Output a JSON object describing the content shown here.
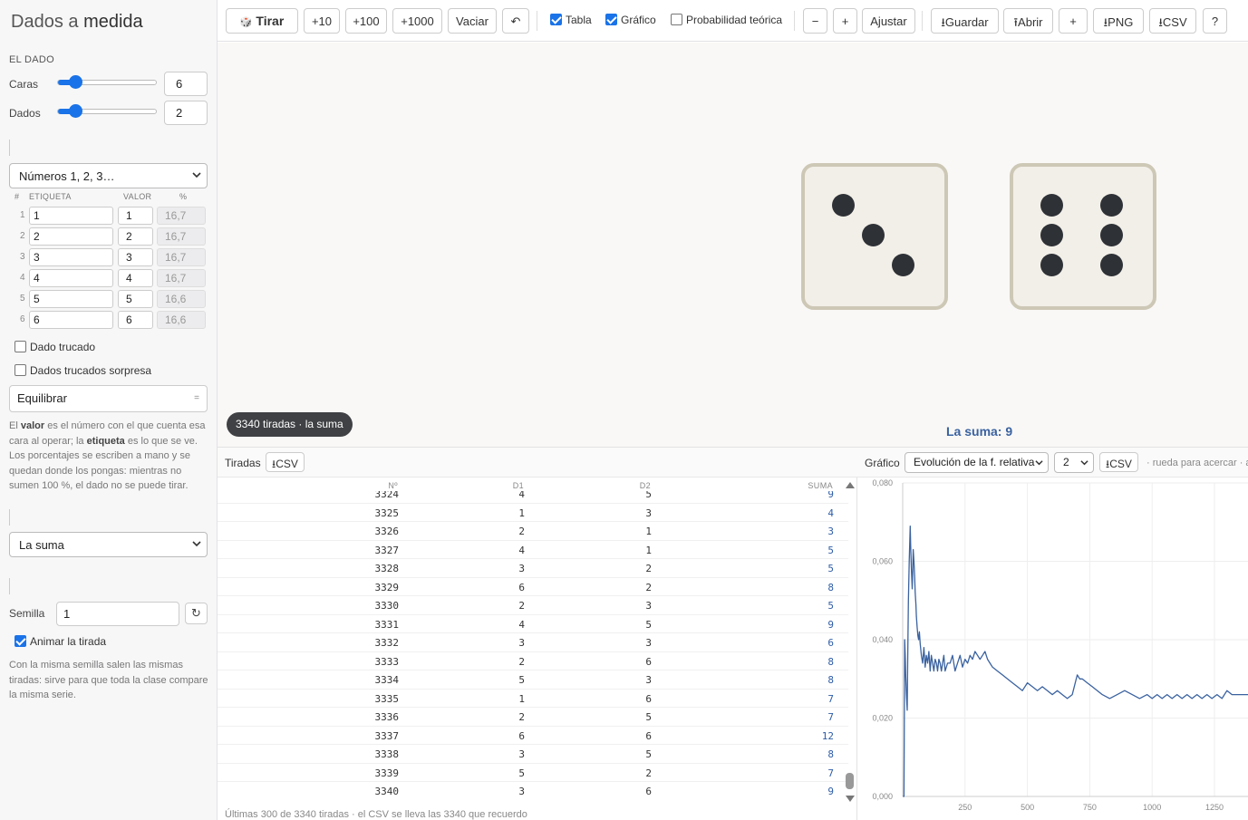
{
  "app": {
    "title_light": "Dados a ",
    "title_bold": "medida"
  },
  "sidebar": {
    "section_die": "EL DADO",
    "faces_label": "Caras",
    "faces_value": "6",
    "faces_level": 0.1,
    "dice_label": "Dados",
    "dice_value": "2",
    "dice_level": 0.1,
    "preset_select": "Números 1, 2, 3…",
    "table_headers": {
      "idx": "#",
      "label": "ETIQUETA",
      "value": "VALOR",
      "pct": "%"
    },
    "faces": [
      {
        "idx": "1",
        "label": "1",
        "value": "1",
        "pct": "16,7"
      },
      {
        "idx": "2",
        "label": "2",
        "value": "2",
        "pct": "16,7"
      },
      {
        "idx": "3",
        "label": "3",
        "value": "3",
        "pct": "16,7"
      },
      {
        "idx": "4",
        "label": "4",
        "value": "4",
        "pct": "16,7"
      },
      {
        "idx": "5",
        "label": "5",
        "value": "5",
        "pct": "16,6"
      },
      {
        "idx": "6",
        "label": "6",
        "value": "6",
        "pct": "16,6"
      }
    ],
    "loaded_die": {
      "label": "Dado trucado",
      "checked": false
    },
    "surprise_dice": {
      "label": "Dados trucados sorpresa",
      "checked": false
    },
    "balance_button": "Equilibrar",
    "balance_icon": "=",
    "help_value": {
      "p1": "El ",
      "b1": "valor",
      "p2": " es el número con el que cuenta esa cara al operar; la ",
      "b2": "etiqueta",
      "p3": " es lo que se ve. Los porcentajes se escriben a mano y se quedan donde los pongas: mientras no sumen 100 %, el dado no se puede tirar."
    },
    "operation_select": "La suma",
    "seed_label": "Semilla",
    "seed_value": "1",
    "refresh_icon": "↻",
    "animate": {
      "label": "Animar la tirada",
      "checked": true
    },
    "help_seed": "Con la misma semilla salen las mismas tiradas: sirve para que toda la clase compare la misma serie."
  },
  "toolbar": {
    "roll_icon": "🎲",
    "roll": "Tirar",
    "plus10": "+10",
    "plus100": "+100",
    "plus1000": "+1000",
    "clear": "Vaciar",
    "undo_icon": "↶",
    "table_check": {
      "label": "Tabla",
      "checked": true
    },
    "chart_check": {
      "label": "Gráfico",
      "checked": true
    },
    "theory_check": {
      "label": "Probabilidad teórica",
      "checked": false
    },
    "minus": "−",
    "plus": "+",
    "fit": "Ajustar",
    "save": "⭳Guardar",
    "open": "⭱Abrir",
    "add": "+",
    "png": "⭳PNG",
    "csv": "⭳CSV",
    "help": "?"
  },
  "stage": {
    "dice_faces": [
      3,
      6
    ],
    "die_color": "#f2efe8",
    "pip_color": "#2e3136",
    "summary_pill": "3340 tiradas · la suma",
    "result": "La suma: 9"
  },
  "table_panel": {
    "title": "Tiradas",
    "csv_button": "⭳CSV",
    "headers": {
      "n": "Nº",
      "d1": "D1",
      "d2": "D2",
      "sum": "SUMA"
    },
    "rows": [
      [
        "3324",
        "4",
        "5",
        "9"
      ],
      [
        "3325",
        "1",
        "3",
        "4"
      ],
      [
        "3326",
        "2",
        "1",
        "3"
      ],
      [
        "3327",
        "4",
        "1",
        "5"
      ],
      [
        "3328",
        "3",
        "2",
        "5"
      ],
      [
        "3329",
        "6",
        "2",
        "8"
      ],
      [
        "3330",
        "2",
        "3",
        "5"
      ],
      [
        "3331",
        "4",
        "5",
        "9"
      ],
      [
        "3332",
        "3",
        "3",
        "6"
      ],
      [
        "3333",
        "2",
        "6",
        "8"
      ],
      [
        "3334",
        "5",
        "3",
        "8"
      ],
      [
        "3335",
        "1",
        "6",
        "7"
      ],
      [
        "3336",
        "2",
        "5",
        "7"
      ],
      [
        "3337",
        "6",
        "6",
        "12"
      ],
      [
        "3338",
        "3",
        "5",
        "8"
      ],
      [
        "3339",
        "5",
        "2",
        "7"
      ],
      [
        "3340",
        "3",
        "6",
        "9"
      ]
    ],
    "footer": "Últimas 300 de 3340 tiradas · el CSV se lleva las 3340 que recuerdo"
  },
  "chart_panel": {
    "title": "Gráfico",
    "mode_select": "Evolución de la f. relativa",
    "outcome_select": "2",
    "csv_button": "⭳CSV",
    "hint": "· rueda para acercar · a"
  },
  "chart_data": {
    "type": "line",
    "title": "",
    "xlabel": "",
    "ylabel": "",
    "xlim": [
      0,
      1400
    ],
    "ylim": [
      0,
      0.08
    ],
    "x_ticks": [
      "250",
      "500",
      "750",
      "1000",
      "1250"
    ],
    "x_tick_values": [
      250,
      500,
      750,
      1000,
      1250
    ],
    "y_ticks": [
      "0,000",
      "0,020",
      "0,040",
      "0,060",
      "0,080"
    ],
    "y_tick_values": [
      0,
      0.02,
      0.04,
      0.06,
      0.08
    ],
    "grid": true,
    "line_color": "#3a62a0",
    "series": [
      {
        "x": [
          1,
          2,
          3,
          5,
          8,
          10,
          12,
          15,
          18,
          20,
          23,
          26,
          30,
          32,
          35,
          38,
          40,
          42,
          45,
          48,
          50,
          53,
          55,
          58,
          61,
          64,
          67,
          70,
          75,
          80,
          85,
          90,
          95,
          100,
          105,
          110,
          115,
          120,
          125,
          130,
          135,
          140,
          145,
          150,
          155,
          160,
          165,
          170,
          180,
          190,
          200,
          210,
          220,
          230,
          240,
          250,
          260,
          270,
          280,
          290,
          300,
          310,
          320,
          330,
          340,
          350,
          360,
          380,
          400,
          420,
          440,
          460,
          480,
          500,
          520,
          540,
          560,
          580,
          600,
          620,
          640,
          660,
          680,
          700,
          710,
          720,
          740,
          760,
          780,
          800,
          830,
          860,
          890,
          920,
          950,
          980,
          1000,
          1020,
          1040,
          1060,
          1080,
          1100,
          1120,
          1140,
          1160,
          1180,
          1200,
          1220,
          1240,
          1260,
          1280,
          1300,
          1320,
          1340,
          1360,
          1380,
          1400
        ],
        "y": [
          0,
          0,
          0,
          0,
          0.04,
          0.036,
          0.031,
          0.026,
          0.022,
          0.034,
          0.05,
          0.06,
          0.069,
          0.064,
          0.058,
          0.053,
          0.057,
          0.063,
          0.06,
          0.056,
          0.052,
          0.049,
          0.046,
          0.043,
          0.041,
          0.04,
          0.042,
          0.039,
          0.036,
          0.034,
          0.038,
          0.033,
          0.036,
          0.034,
          0.037,
          0.032,
          0.036,
          0.034,
          0.032,
          0.035,
          0.034,
          0.032,
          0.035,
          0.034,
          0.032,
          0.034,
          0.036,
          0.032,
          0.034,
          0.034,
          0.036,
          0.032,
          0.034,
          0.036,
          0.033,
          0.035,
          0.034,
          0.036,
          0.035,
          0.037,
          0.036,
          0.035,
          0.036,
          0.037,
          0.035,
          0.034,
          0.033,
          0.032,
          0.031,
          0.03,
          0.029,
          0.028,
          0.027,
          0.029,
          0.028,
          0.027,
          0.028,
          0.027,
          0.026,
          0.027,
          0.026,
          0.025,
          0.026,
          0.031,
          0.03,
          0.03,
          0.029,
          0.028,
          0.027,
          0.026,
          0.025,
          0.026,
          0.027,
          0.026,
          0.025,
          0.026,
          0.025,
          0.026,
          0.025,
          0.026,
          0.025,
          0.026,
          0.025,
          0.026,
          0.025,
          0.026,
          0.025,
          0.026,
          0.025,
          0.026,
          0.025,
          0.027,
          0.026,
          0.026,
          0.026,
          0.026,
          0.026
        ]
      }
    ]
  }
}
